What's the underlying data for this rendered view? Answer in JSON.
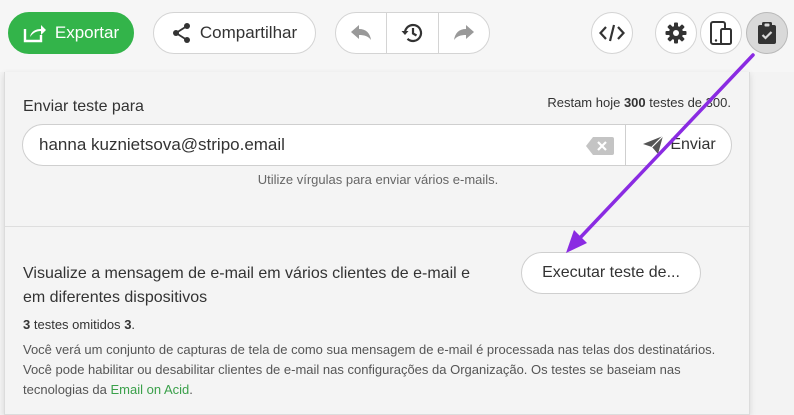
{
  "toolbar": {
    "export_label": "Exportar",
    "share_label": "Compartilhar"
  },
  "send_test": {
    "title": "Enviar teste para",
    "quota_prefix": "Restam hoje",
    "quota_remaining": "300",
    "quota_middle": "testes de",
    "quota_total": "300",
    "quota_suffix": ".",
    "email_value": "hanna kuznietsova@stripo.email",
    "send_label": "Enviar",
    "hint": "Utilize vírgulas para enviar vários e-mails."
  },
  "preview": {
    "title": "Visualize a mensagem de e-mail em vários clientes de e-mail e em diferentes dispositivos",
    "run_label": "Executar teste de...",
    "omitted_count": "3",
    "omitted_text": "testes omitidos",
    "omitted_count2": "3",
    "omitted_suffix": ".",
    "desc_text": "Você verá um conjunto de capturas de tela de como sua mensagem de e-mail é processada nas telas dos destinatários. Você pode habilitar ou desabilitar clientes de e-mail nas configurações da Organização. Os testes se baseiam nas tecnologias da",
    "desc_link": "Email on Acid",
    "desc_end": "."
  },
  "colors": {
    "export_green": "#33b44a",
    "annotation_arrow": "#8a2be2",
    "link_green": "#3aa04a"
  }
}
